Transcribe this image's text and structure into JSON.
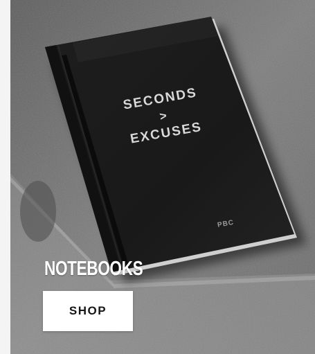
{
  "promo": {
    "category_title": "NOTEBOOKS",
    "shop_label": "SHOP"
  },
  "notebook_cover": {
    "line1": "SECONDS",
    "line2": ">",
    "line3": "EXCUSES",
    "brand_mark": "PBC"
  },
  "colors": {
    "title_text": "#ffffff",
    "button_background": "#ffffff",
    "button_text": "#151515",
    "notebook_cover": "#1b1b1b",
    "concrete": "#7a7a7a"
  }
}
